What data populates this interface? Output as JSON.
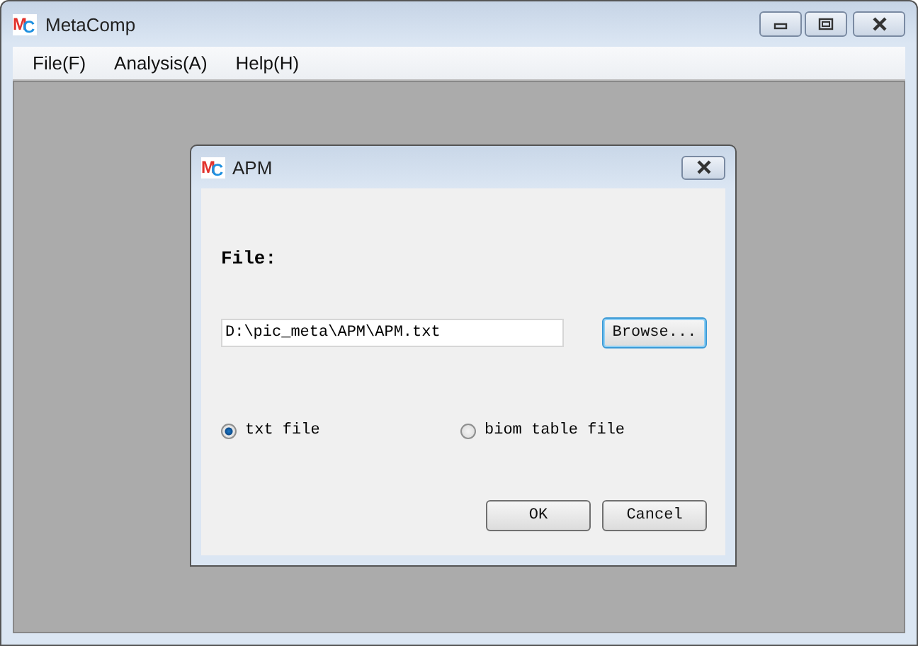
{
  "window": {
    "logo": "MC",
    "title": "MetaComp"
  },
  "menu": [
    "File(F)",
    "Analysis(A)",
    "Help(H)"
  ],
  "dialog": {
    "logo": "MC",
    "title": "APM",
    "file_label": "File:",
    "file_field": {
      "value": "D:\\pic_meta\\APM\\APM.txt"
    },
    "browse_button": {
      "label": "Browse...",
      "focused": true
    },
    "options": [
      {
        "label": "txt file",
        "selected": true
      },
      {
        "label": "biom table file",
        "selected": false
      }
    ],
    "buttons": [
      "OK",
      "Cancel"
    ]
  }
}
